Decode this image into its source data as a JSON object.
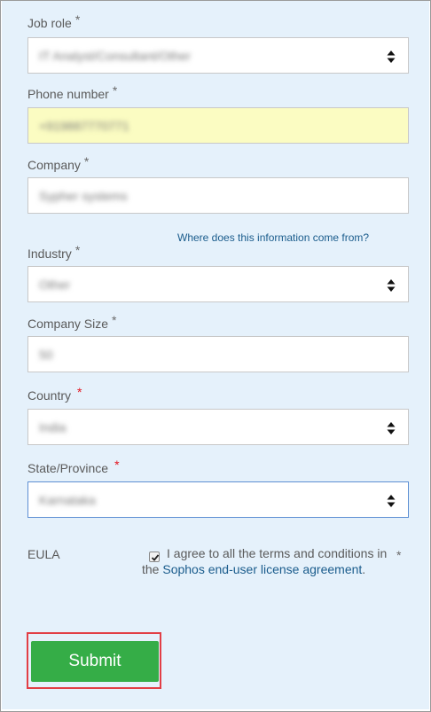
{
  "form": {
    "job_role": {
      "label": "Job role",
      "required_mark": "*",
      "value": "IT Analyst/Consultant/Other"
    },
    "phone": {
      "label": "Phone number",
      "required_mark": "*",
      "value": "+919887770771"
    },
    "company": {
      "label": "Company",
      "required_mark": "*",
      "value": "Sypher systems"
    },
    "help_link": "Where does this information come from?",
    "industry": {
      "label": "Industry",
      "required_mark": "*",
      "value": "Other"
    },
    "company_size": {
      "label": "Company Size",
      "required_mark": "*",
      "value": "50"
    },
    "country": {
      "label": "Country",
      "required_mark": "*",
      "value": "India"
    },
    "state": {
      "label": "State/Province",
      "required_mark": "*",
      "value": "Karnataka"
    },
    "eula": {
      "label": "EULA",
      "required_mark": "*",
      "checked": true,
      "text_before": "I agree to all the terms and conditions in the",
      "link_text": "Sophos end-user license agreement",
      "text_after": "."
    },
    "submit_label": "Submit"
  },
  "colors": {
    "panel_bg": "#e5f1fb",
    "highlight_field": "#fbfcc2",
    "link": "#1a5c8c",
    "submit_bg": "#35ad47",
    "outline_red": "#e23e45",
    "required_red": "#e4151f"
  },
  "icons": {
    "select_arrows": "sort-arrows-icon",
    "check": "checkmark-icon"
  }
}
